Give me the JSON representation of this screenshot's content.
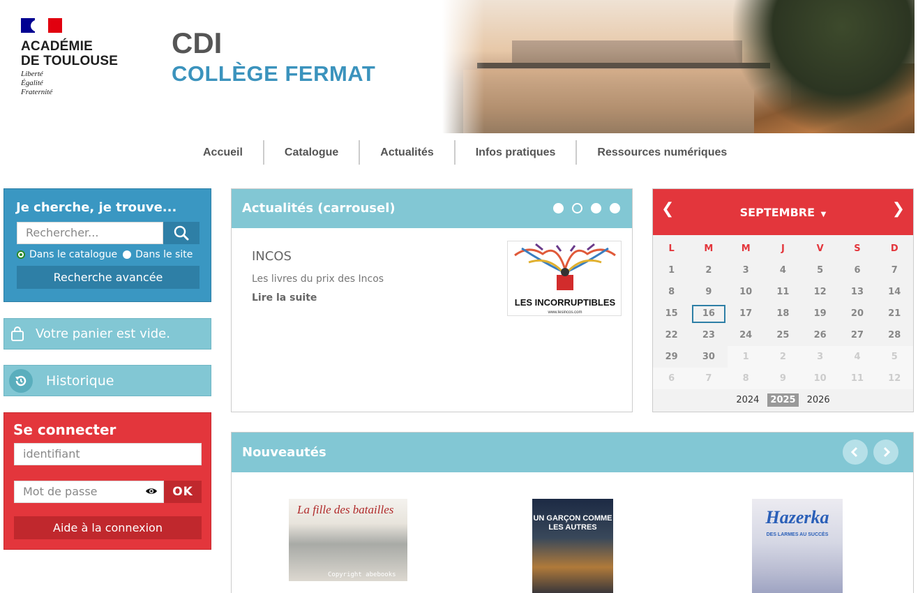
{
  "header": {
    "logo": {
      "title_line1": "ACADÉMIE",
      "title_line2": "DE TOULOUSE",
      "motto1": "Liberté",
      "motto2": "Égalité",
      "motto3": "Fraternité"
    },
    "site_title": "CDI",
    "site_subtitle": "COLLÈGE FERMAT"
  },
  "nav": {
    "items": [
      "Accueil",
      "Catalogue",
      "Actualités",
      "Infos pratiques",
      "Ressources numériques"
    ]
  },
  "search": {
    "title": "Je cherche, je trouve...",
    "placeholder": "Rechercher...",
    "option_catalogue": "Dans le catalogue",
    "option_site": "Dans le site",
    "advanced_label": "Recherche avancée"
  },
  "panier": {
    "label": "Votre panier est vide."
  },
  "historique": {
    "label": "Historique"
  },
  "login": {
    "title": "Se connecter",
    "id_placeholder": "identifiant",
    "pw_placeholder": "Mot de passe",
    "ok_label": "OK",
    "help_label": "Aide à la connexion"
  },
  "news": {
    "title": "Actualités (carrousel)",
    "active_dot": 2,
    "item_title": "INCOS",
    "item_desc": "Les livres du prix des Incos",
    "item_more": "Lire la suite",
    "image_label": "LES INCORRUPTIBLES",
    "image_url_text": "www.lesincos.com"
  },
  "calendar": {
    "month": "SEPTEMBRE",
    "dow": [
      "L",
      "M",
      "M",
      "J",
      "V",
      "S",
      "D"
    ],
    "weeks": [
      [
        "1",
        "2",
        "3",
        "4",
        "5",
        "6",
        "7"
      ],
      [
        "8",
        "9",
        "10",
        "11",
        "12",
        "13",
        "14"
      ],
      [
        "15",
        "16",
        "17",
        "18",
        "19",
        "20",
        "21"
      ],
      [
        "22",
        "23",
        "24",
        "25",
        "26",
        "27",
        "28"
      ],
      [
        "29",
        "30",
        "1",
        "2",
        "3",
        "4",
        "5"
      ],
      [
        "6",
        "7",
        "8",
        "9",
        "10",
        "11",
        "12"
      ]
    ],
    "today": "16",
    "years": [
      "2024",
      "2025",
      "2026"
    ],
    "selected_year": "2025"
  },
  "nouveautes": {
    "title": "Nouveautés",
    "books": [
      {
        "title": "La fille des batailles",
        "watermark": "Copyright abebooks"
      },
      {
        "title": "UN GARÇON COMME LES AUTRES"
      },
      {
        "title": "Hazerka",
        "subtitle": "DES LARMES AU SUCCÈS"
      }
    ]
  },
  "colors": {
    "blue": "#3a97c2",
    "teal": "#82c7d4",
    "red": "#e3363c",
    "dark_red": "#c0282d",
    "title_blue": "#3b93bd"
  }
}
